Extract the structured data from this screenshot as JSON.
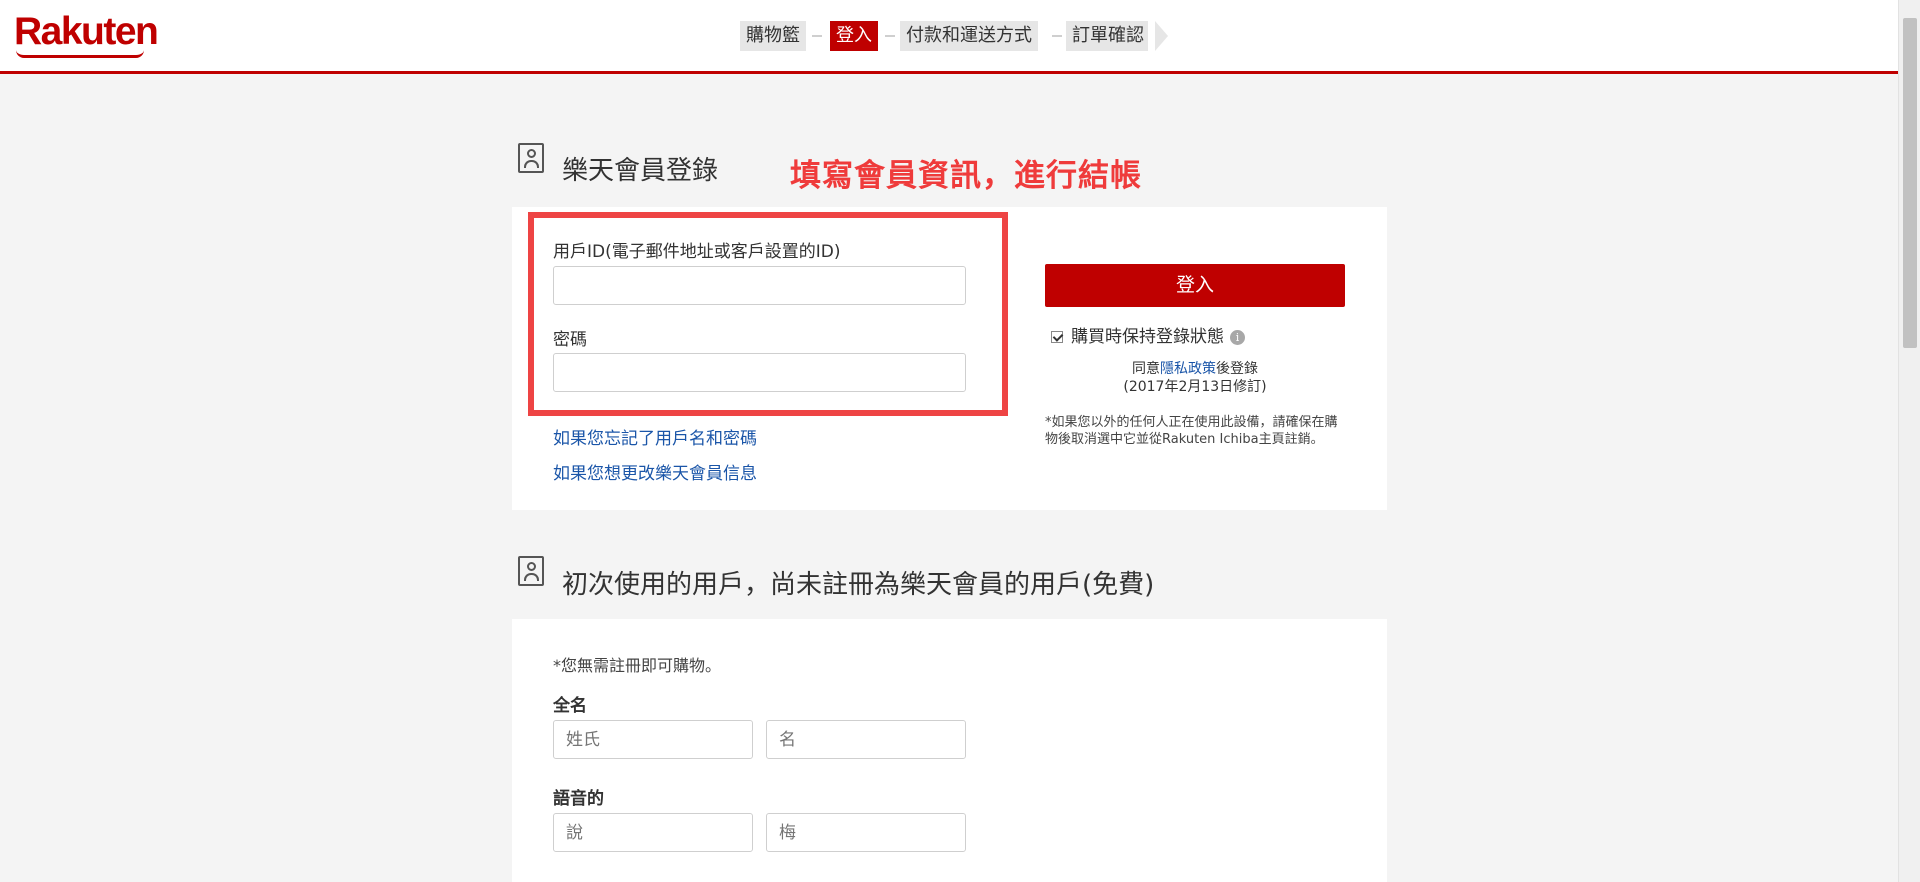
{
  "header": {
    "logo": "Rakuten",
    "steps": [
      "購物籃",
      "登入",
      "付款和運送方式",
      "訂單確認"
    ],
    "active_step": 1
  },
  "login_section": {
    "title": "樂天會員登錄",
    "promo_text": "填寫會員資訊，進行結帳",
    "user_id_label": "用戶ID(電子郵件地址或客戶設置的ID)",
    "user_id_value": "",
    "password_label": "密碼",
    "password_value": "",
    "forgot_link": "如果您忘記了用戶名和密碼",
    "change_link": "如果您想更改樂天會員信息",
    "login_button": "登入",
    "keep_logged_in": "購買時保持登錄狀態",
    "keep_logged_in_checked": true,
    "policy_prefix": "同意",
    "policy_link": "隱私政策",
    "policy_suffix": "後登錄",
    "policy_date": "(2017年2月13日修訂)",
    "shared_device_note": "*如果您以外的任何人正在使用此設備，請確保在購物後取消選中它並從Rakuten Ichiba主頁註銷。"
  },
  "guest_section": {
    "title": "初次使用的用戶，尚未註冊為樂天會員的用戶(免費)",
    "note": "*您無需註冊即可購物。",
    "full_name_label": "全名",
    "last_name_placeholder": "姓氏",
    "first_name_placeholder": "名",
    "phonetic_label": "語音的",
    "phonetic_last_placeholder": "說",
    "phonetic_first_placeholder": "梅"
  },
  "colors": {
    "brand_red": "#bf0000",
    "promo_red": "#ef3b3b",
    "highlight_red": "#ee4444",
    "link_blue": "#1a55a8"
  }
}
